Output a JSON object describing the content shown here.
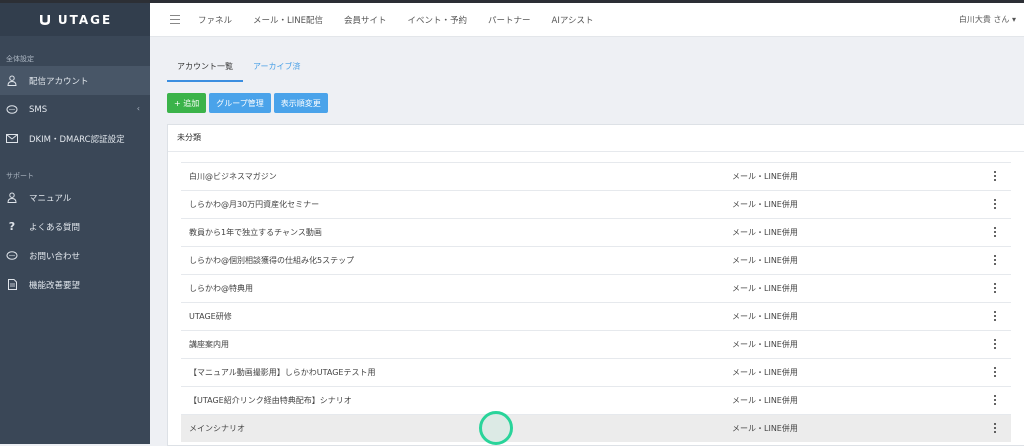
{
  "brand": {
    "name": "UTAGE"
  },
  "sidebar": {
    "section1": "全体設定",
    "items1": [
      {
        "label": "配信アカウント",
        "icon": "user-icon",
        "active": true
      },
      {
        "label": "SMS",
        "icon": "chat-icon",
        "chevron": "‹"
      },
      {
        "label": "DKIM・DMARC認証設定",
        "icon": "mail-icon"
      }
    ],
    "section2": "サポート",
    "items2": [
      {
        "label": "マニュアル",
        "icon": "user-icon"
      },
      {
        "label": "よくある質問",
        "icon": "question-icon"
      },
      {
        "label": "お問い合わせ",
        "icon": "chat-icon"
      },
      {
        "label": "機能改善要望",
        "icon": "document-icon"
      }
    ]
  },
  "header": {
    "menu": [
      "ファネル",
      "メール・LINE配信",
      "会員サイト",
      "イベント・予約",
      "パートナー",
      "AIアシスト"
    ],
    "user": "白川大貴 さん ▾"
  },
  "tabs": [
    "アカウント一覧",
    "アーカイブ済"
  ],
  "buttons": {
    "add": "+ 追加",
    "group": "グループ管理",
    "order": "表示順変更"
  },
  "panel": {
    "title": "未分類",
    "rows": [
      {
        "name": "白川@ビジネスマガジン",
        "type": "メール・LINE併用"
      },
      {
        "name": "しらかわ@月30万円資産化セミナー",
        "type": "メール・LINE併用"
      },
      {
        "name": "教員から1年で独立するチャンス動画",
        "type": "メール・LINE併用"
      },
      {
        "name": "しらかわ@個別相談獲得の仕組み化5ステップ",
        "type": "メール・LINE併用"
      },
      {
        "name": "しらかわ@特典用",
        "type": "メール・LINE併用"
      },
      {
        "name": "UTAGE研修",
        "type": "メール・LINE併用"
      },
      {
        "name": "講座案内用",
        "type": "メール・LINE併用"
      },
      {
        "name": "【マニュアル動画撮影用】しらかわUTAGEテスト用",
        "type": "メール・LINE併用"
      },
      {
        "name": "【UTAGE紹介リンク経由特典配布】シナリオ",
        "type": "メール・LINE併用"
      },
      {
        "name": "メインシナリオ",
        "type": "メール・LINE併用"
      }
    ]
  },
  "colors": {
    "sidebar": "#3a4757",
    "accent": "#4aa3ea",
    "add": "#3bb34a"
  }
}
